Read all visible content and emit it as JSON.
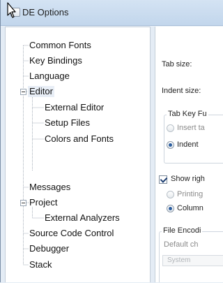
{
  "window": {
    "title": "DE Options"
  },
  "tree": {
    "items": [
      {
        "id": "common-fonts",
        "label": "Common Fonts"
      },
      {
        "id": "key-bindings",
        "label": "Key Bindings"
      },
      {
        "id": "language",
        "label": "Language"
      },
      {
        "id": "editor",
        "label": "Editor",
        "expanded": true,
        "selected": true
      },
      {
        "id": "external-editor",
        "label": "External Editor"
      },
      {
        "id": "setup-files",
        "label": "Setup Files"
      },
      {
        "id": "colors-and-fonts",
        "label": "Colors and Fonts"
      },
      {
        "id": "messages",
        "label": "Messages"
      },
      {
        "id": "project",
        "label": "Project",
        "expanded": true
      },
      {
        "id": "external-analyzers",
        "label": "External Analyzers"
      },
      {
        "id": "source-code-control",
        "label": "Source Code Control"
      },
      {
        "id": "debugger",
        "label": "Debugger"
      },
      {
        "id": "stack",
        "label": "Stack"
      }
    ]
  },
  "editor": {
    "tab_size_label": "Tab size:",
    "indent_size_label": "Indent size:",
    "tab_key_group_title": "Tab Key Fu",
    "insert_tab_label": "Insert ta",
    "indent_label": "Indent",
    "tab_key_mode": "indent",
    "show_right_label": "Show righ",
    "show_right_checked": true,
    "printing_label": "Printing",
    "column_label": "Column",
    "margin_mode": "column",
    "file_encoding_group_title": "File Encodi",
    "default_charset_label": "Default ch",
    "charset_value": "System"
  },
  "colors": {
    "titlebar": "#c8daee",
    "selection": "#e8eef6",
    "radio_dot": "#2b5d9e"
  }
}
